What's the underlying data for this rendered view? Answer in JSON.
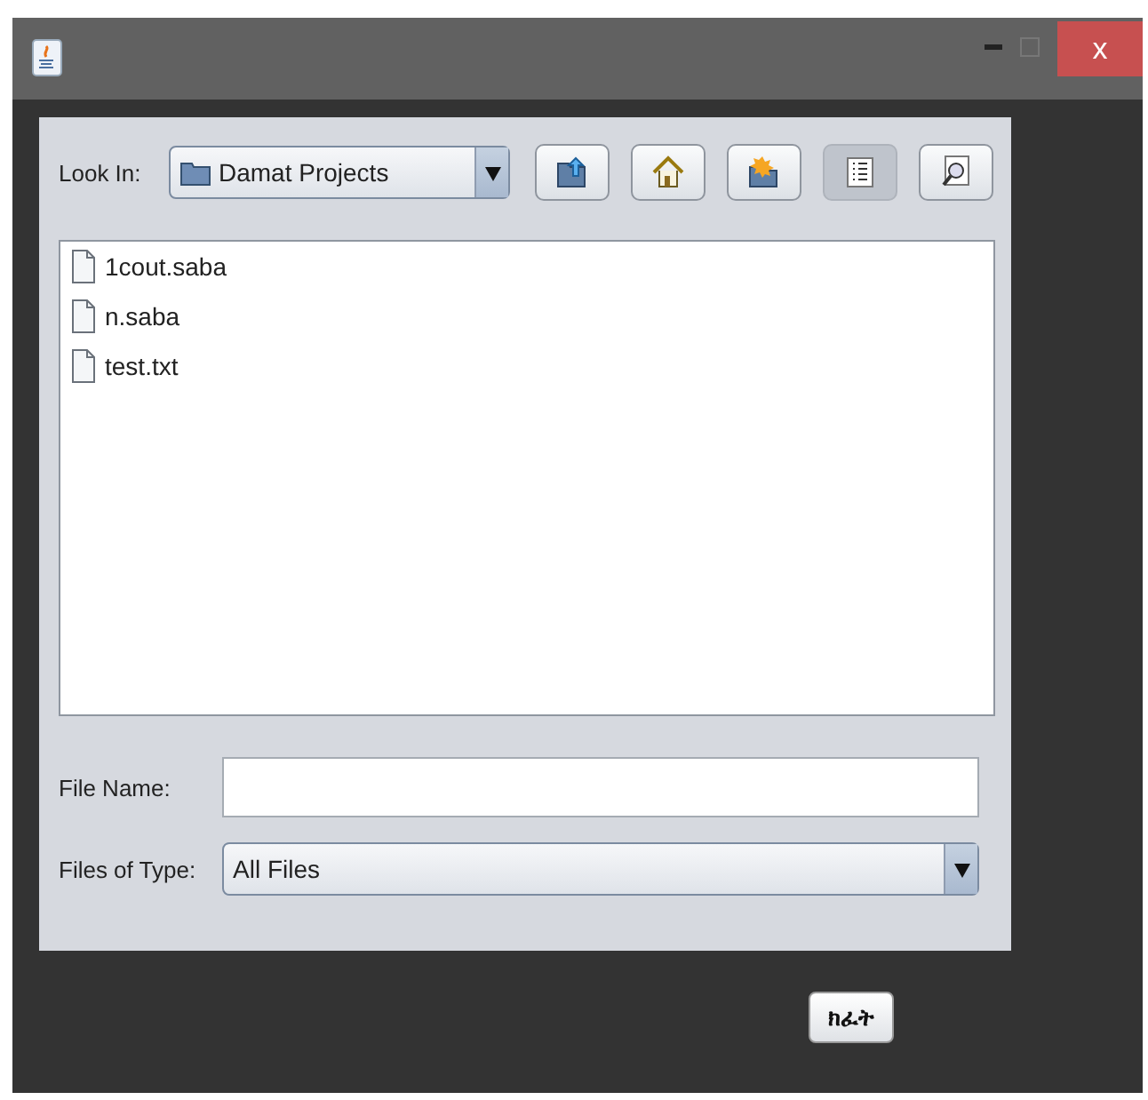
{
  "window": {
    "close_label": "x"
  },
  "look_in": {
    "label": "Look In:",
    "value": "Damat Projects"
  },
  "toolbar": [
    {
      "kind": "up",
      "selected": false
    },
    {
      "kind": "home",
      "selected": false
    },
    {
      "kind": "newfolder",
      "selected": false
    },
    {
      "kind": "list",
      "selected": true
    },
    {
      "kind": "details",
      "selected": false
    }
  ],
  "files": [
    "1cout.saba",
    "n.saba",
    "test.txt"
  ],
  "file_name": {
    "label": "File Name:"
  },
  "files_of_type": {
    "label": "Files of Type:",
    "value": "All Files"
  },
  "open_button": "ክፈት"
}
